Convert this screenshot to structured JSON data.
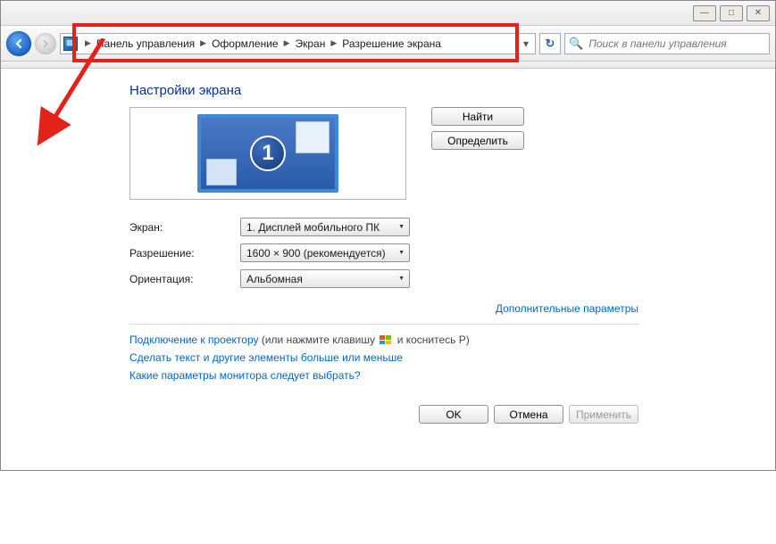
{
  "window": {
    "minimize": "—",
    "maximize": "□",
    "close": "✕"
  },
  "breadcrumb": {
    "items": [
      "Панель управления",
      "Оформление",
      "Экран",
      "Разрешение экрана"
    ]
  },
  "search": {
    "placeholder": "Поиск в панели управления"
  },
  "page_title": "Настройки экрана",
  "buttons": {
    "find": "Найти",
    "identify": "Определить",
    "ok": "OK",
    "cancel": "Отмена",
    "apply": "Применить"
  },
  "monitor": {
    "number": "1"
  },
  "form": {
    "display_label": "Экран:",
    "display_value": "1. Дисплей мобильного ПК",
    "resolution_label": "Разрешение:",
    "resolution_value": "1600 × 900 (рекомендуется)",
    "orientation_label": "Ориентация:",
    "orientation_value": "Альбомная"
  },
  "links": {
    "advanced": "Дополнительные параметры",
    "projector_a": "Подключение к проектору",
    "projector_b": "(или нажмите клавишу",
    "projector_c": "и коснитесь P)",
    "textsize": "Сделать текст и другие элементы больше или меньше",
    "monitor_params": "Какие параметры монитора следует выбрать?"
  }
}
